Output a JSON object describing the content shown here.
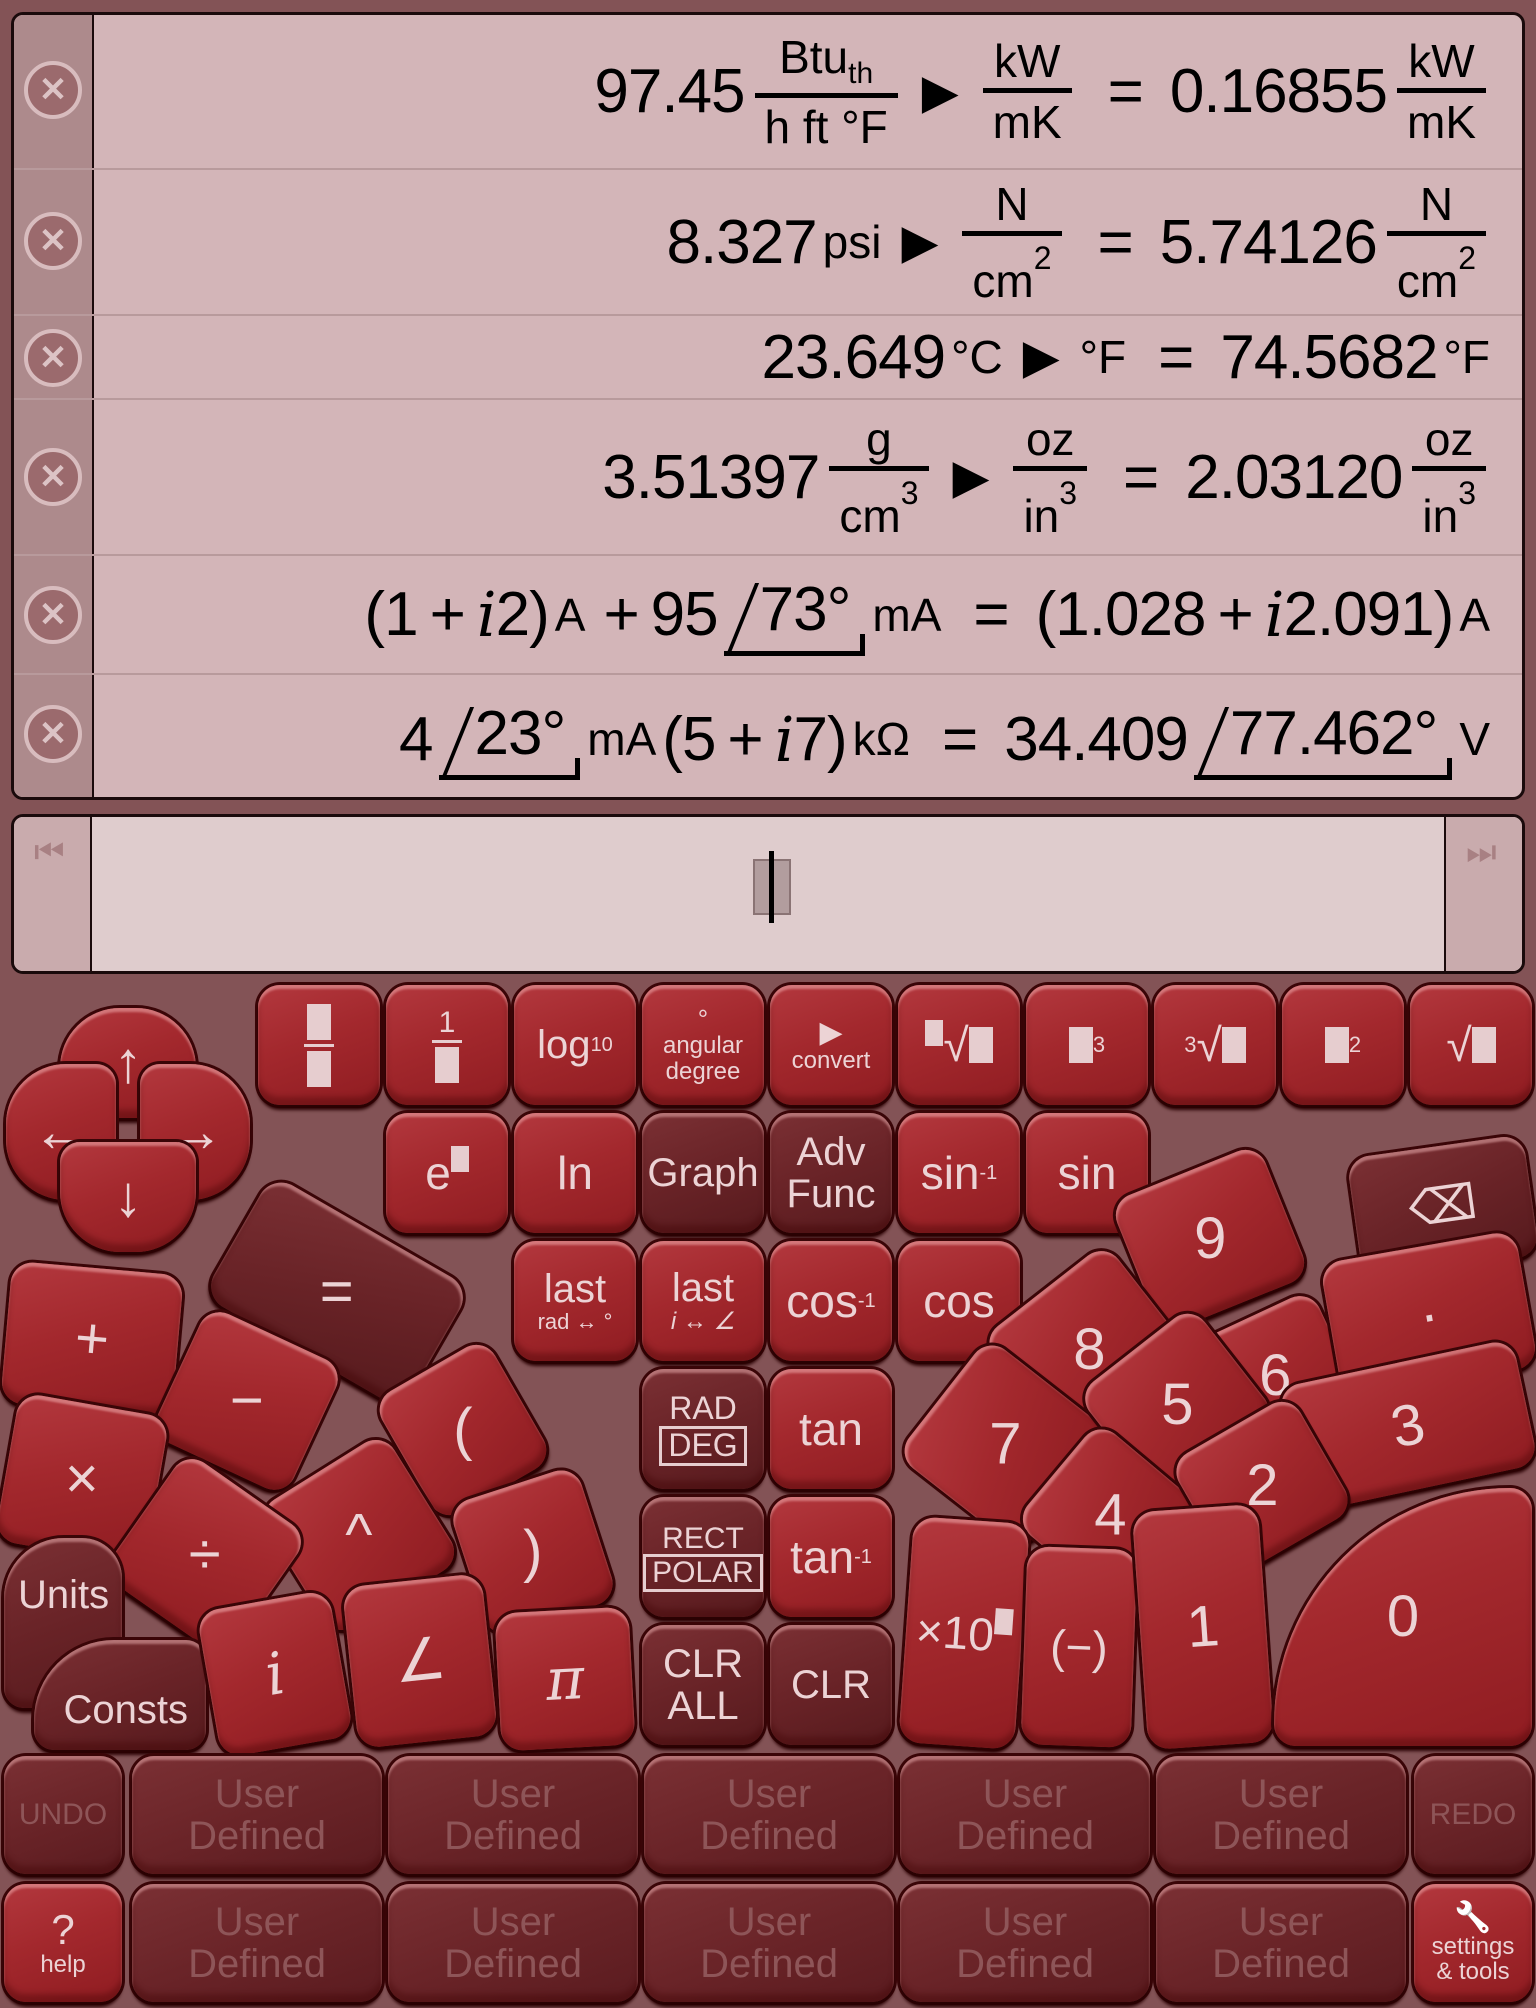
{
  "history": [
    {
      "input_value": "97.45",
      "input_unit_num": "Btu",
      "input_unit_num_sub": "th",
      "input_unit_den": "h ft °F",
      "op": "▶",
      "target_num": "kW",
      "target_den": "mK",
      "equals": "=",
      "result": "0.16855",
      "result_num": "kW",
      "result_den": "mK"
    },
    {
      "input_value": "8.327",
      "input_unit": "psi",
      "op": "▶",
      "target_num": "N",
      "target_den": "cm",
      "target_den_exp": "2",
      "equals": "=",
      "result": "5.74126",
      "result_num": "N",
      "result_den": "cm",
      "result_den_exp": "2"
    },
    {
      "input_value": "23.649",
      "input_unit": "°C",
      "op": "▶",
      "target": "°F",
      "equals": "=",
      "result": "74.5682",
      "result_unit": "°F"
    },
    {
      "input_value": "3.51397",
      "input_unit_num": "g",
      "input_unit_den": "cm",
      "input_unit_den_exp": "3",
      "op": "▶",
      "target_num": "oz",
      "target_den": "in",
      "target_den_exp": "3",
      "equals": "=",
      "result": "2.03120",
      "result_num": "oz",
      "result_den": "in",
      "result_den_exp": "3"
    },
    {
      "lparen": "(",
      "a_re": "1",
      "plus": "+",
      "i": "i",
      "a_im": "2",
      "rparen": ")",
      "a_unit": "A",
      "plus2": "+",
      "b_mag": "95",
      "b_ang": "73°",
      "b_unit": "mA",
      "equals": "=",
      "r_re": "1.028",
      "r_im": "2.091",
      "r_unit": "A"
    },
    {
      "a_mag": "4",
      "a_ang": "23°",
      "a_unit": "mA",
      "b_re": "5",
      "plus": "+",
      "i": "i",
      "b_im": "7",
      "b_unit": "kΩ",
      "equals": "=",
      "r_mag": "34.409",
      "r_ang": "77.462°",
      "r_unit": "V"
    }
  ],
  "history_delete_icon": "⊗",
  "input": {
    "value": "",
    "nav_left": "⏮",
    "nav_right": "⏭"
  },
  "keys": {
    "frac": "",
    "recip_one": "1",
    "log10": "log",
    "log10_sub": "10",
    "angular_deg_sym": "°",
    "angular_deg": "angular",
    "angular_deg2": "degree",
    "convert_sym": "▶",
    "convert": "convert",
    "nth_root": "√",
    "cube": "3",
    "cube_root_idx": "3",
    "cube_root": "√",
    "square": "2",
    "sqrt": "√",
    "exp": "e",
    "ln": "ln",
    "graph": "Graph",
    "adv1": "Adv",
    "adv2": "Func",
    "asin": "sin",
    "asin_sup": "-1",
    "sin": "sin",
    "last1": "last",
    "last1_sub": "rad ↔ °",
    "last2": "last",
    "last2_sub": "i ↔ ∠",
    "acos": "cos",
    "acos_sup": "-1",
    "cos": "cos",
    "rad": "RAD",
    "deg": "DEG",
    "tan": "tan",
    "rect": "RECT",
    "polar": "POLAR",
    "atan": "tan",
    "atan_sup": "-1",
    "clr_all1": "CLR",
    "clr_all2": "ALL",
    "clr": "CLR",
    "up": "↑",
    "left": "←",
    "right": "→",
    "down": "↓",
    "equals": "=",
    "plus": "+",
    "minus": "−",
    "lparen": "(",
    "times": "×",
    "pow": "^",
    "rparen": ")",
    "divide": "÷",
    "units": "Units",
    "consts": "Consts",
    "imag": "i",
    "angle": "∠",
    "pi": "π",
    "backspace": "⌫",
    "d9": "9",
    "d8": "8",
    "d6": "6",
    "dot": "·",
    "d7": "7",
    "d5": "5",
    "d3": "3",
    "d4": "4",
    "d2": "2",
    "exp10": "×10",
    "neg": "(−)",
    "d1": "1",
    "d0": "0",
    "undo": "UNDO",
    "redo": "REDO",
    "help_sym": "?",
    "help": "help",
    "settings_sym": "🔧",
    "settings1": "settings",
    "settings2": "& tools",
    "user_defined1": "User",
    "user_defined2": "Defined"
  }
}
